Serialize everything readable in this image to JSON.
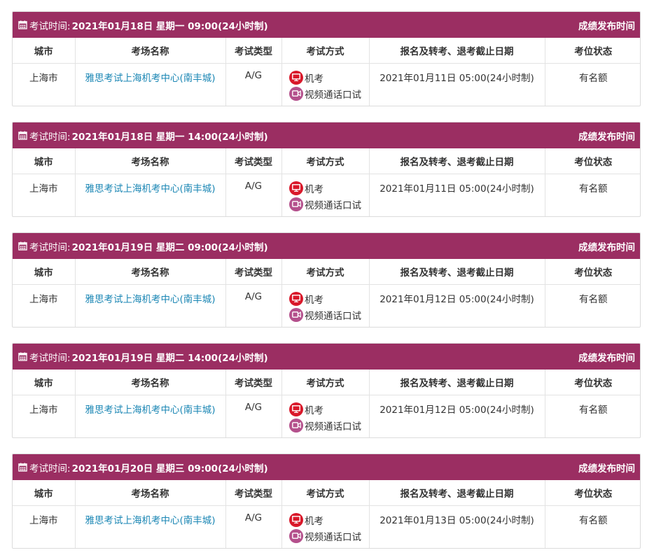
{
  "header_label": "考试时间:",
  "header_right": "成绩发布时间",
  "columns": [
    "城市",
    "考场名称",
    "考试类型",
    "考试方式",
    "报名及转考、退考截止日期",
    "考位状态"
  ],
  "mode_icons": {
    "computer": "monitor-icon",
    "video": "video-camera-icon",
    "calendar": "calendar-icon"
  },
  "colors": {
    "header_bg": "#9b2e62",
    "link": "#1a86b4",
    "computer_icon_bg": "#d9182a",
    "video_icon_bg": "#b4508c"
  },
  "sessions": [
    {
      "time": "2021年01月18日 星期一 09:00(24小时制)",
      "city": "上海市",
      "venue": "雅思考试上海机考中心(南丰城)",
      "type": "A/G",
      "modes": [
        "机考",
        "视频通话口试"
      ],
      "deadline": "2021年01月11日 05:00(24小时制)",
      "status": "有名额"
    },
    {
      "time": "2021年01月18日 星期一 14:00(24小时制)",
      "city": "上海市",
      "venue": "雅思考试上海机考中心(南丰城)",
      "type": "A/G",
      "modes": [
        "机考",
        "视频通话口试"
      ],
      "deadline": "2021年01月11日 05:00(24小时制)",
      "status": "有名额"
    },
    {
      "time": "2021年01月19日 星期二 09:00(24小时制)",
      "city": "上海市",
      "venue": "雅思考试上海机考中心(南丰城)",
      "type": "A/G",
      "modes": [
        "机考",
        "视频通话口试"
      ],
      "deadline": "2021年01月12日 05:00(24小时制)",
      "status": "有名额"
    },
    {
      "time": "2021年01月19日 星期二 14:00(24小时制)",
      "city": "上海市",
      "venue": "雅思考试上海机考中心(南丰城)",
      "type": "A/G",
      "modes": [
        "机考",
        "视频通话口试"
      ],
      "deadline": "2021年01月12日 05:00(24小时制)",
      "status": "有名额"
    },
    {
      "time": "2021年01月20日 星期三 09:00(24小时制)",
      "city": "上海市",
      "venue": "雅思考试上海机考中心(南丰城)",
      "type": "A/G",
      "modes": [
        "机考",
        "视频通话口试"
      ],
      "deadline": "2021年01月13日 05:00(24小时制)",
      "status": "有名额"
    }
  ]
}
